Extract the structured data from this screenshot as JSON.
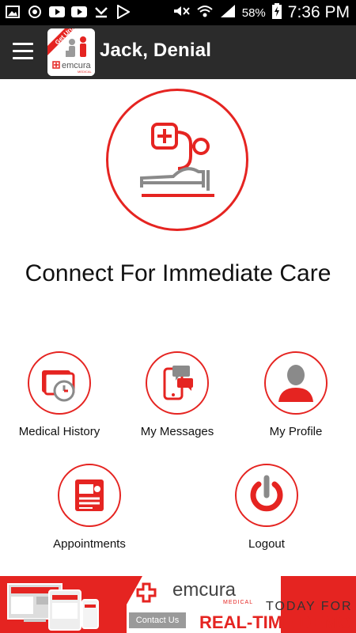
{
  "status_bar": {
    "battery_percent": "58%",
    "time": "7:36 PM"
  },
  "app_bar": {
    "title": "Jack, Denial",
    "logo_badge": "Get Urgent",
    "logo_brand": "emcura",
    "logo_brand_sub": "MEDICAL"
  },
  "hero": {
    "text": "Connect For Immediate Care"
  },
  "menu": {
    "medical_history": "Medical History",
    "my_messages": "My Messages",
    "my_profile": "My Profile",
    "appointments": "Appointments",
    "logout": "Logout"
  },
  "banner": {
    "brand": "emcura",
    "brand_sub": "MEDICAL",
    "cta_top": "TODAY FOR A",
    "cta_main": "REAL-TIME DEMO",
    "contact_button": "Contact Us"
  },
  "colors": {
    "accent": "#e52421",
    "appbar": "#2b2b2b",
    "status_bar": "#000000"
  }
}
